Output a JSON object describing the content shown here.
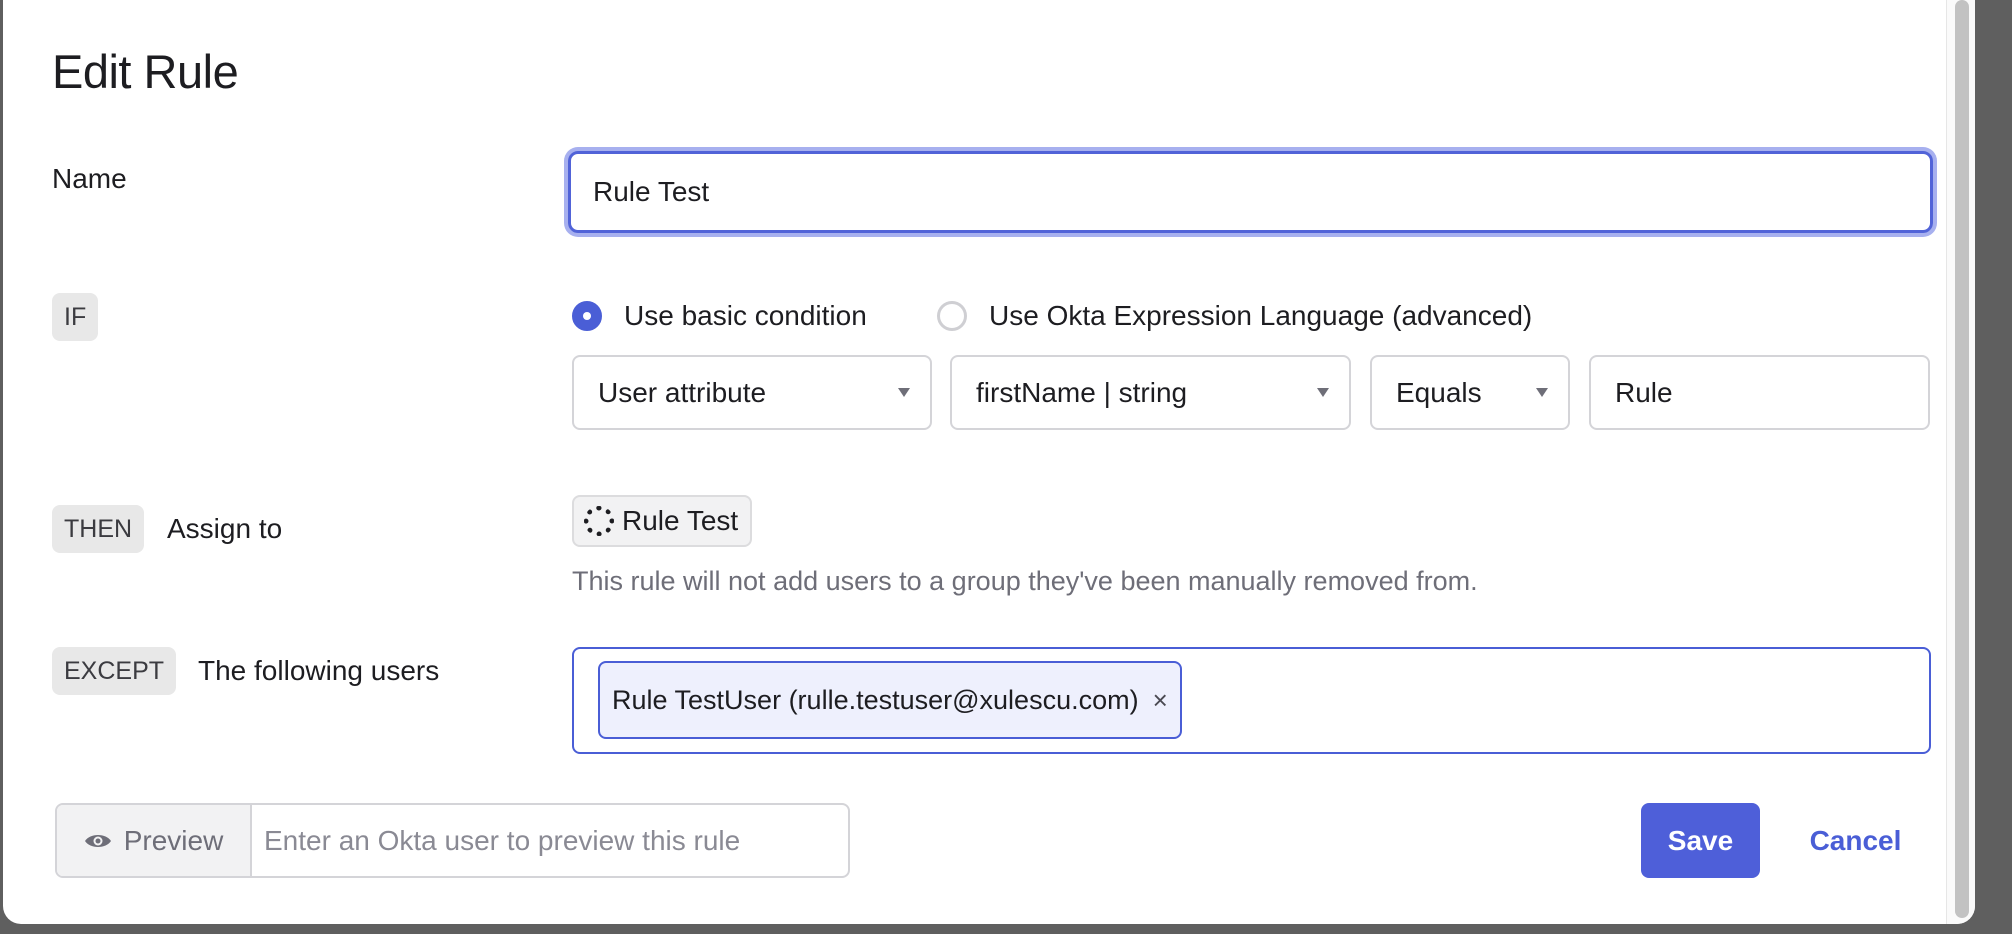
{
  "dialog": {
    "title": "Edit Rule"
  },
  "name_row": {
    "label": "Name",
    "value": "Rule Test"
  },
  "if_row": {
    "chip": "IF",
    "radio_basic": "Use basic condition",
    "radio_advanced": "Use Okta Expression Language (advanced)",
    "selected": "basic",
    "attribute_type": "User attribute",
    "attribute": "firstName | string",
    "operator": "Equals",
    "value": "Rule"
  },
  "then_row": {
    "chip": "THEN",
    "label": "Assign to",
    "group": "Rule Test",
    "hint": "This rule will not add users to a group they've been manually removed from."
  },
  "except_row": {
    "chip": "EXCEPT",
    "label": "The following users",
    "users": [
      {
        "label": "Rule TestUser (rulle.testuser@xulescu.com)",
        "remove": "×"
      }
    ]
  },
  "footer": {
    "preview_label": "Preview",
    "preview_placeholder": "Enter an Okta user to preview this rule",
    "save_label": "Save",
    "cancel_label": "Cancel"
  },
  "colors": {
    "accent": "#4e5fd9",
    "focus_ring": "#a7b0ef"
  }
}
